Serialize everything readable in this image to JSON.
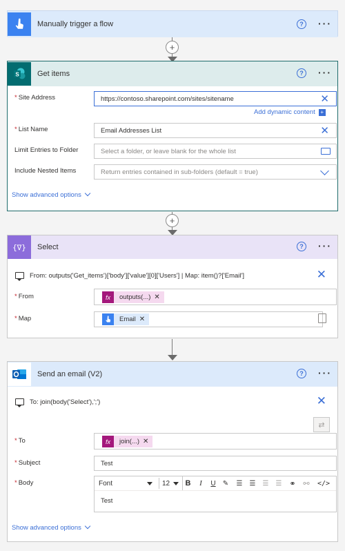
{
  "trigger": {
    "title": "Manually trigger a flow",
    "help": "?",
    "more": "···"
  },
  "get_items": {
    "title": "Get items",
    "help": "?",
    "more": "···",
    "site_address": {
      "label": "Site Address",
      "required": "*",
      "value": "https://contoso.sharepoint.com/sites/sitename"
    },
    "add_dynamic": "Add dynamic content",
    "list_name": {
      "label": "List Name",
      "required": "*",
      "value": "Email Addresses List"
    },
    "limit_folder": {
      "label": "Limit Entries to Folder",
      "placeholder": "Select a folder, or leave blank for the whole list"
    },
    "nested": {
      "label": "Include Nested Items",
      "placeholder": "Return entries contained in sub-folders (default = true)"
    },
    "advanced": "Show advanced options"
  },
  "select": {
    "title": "Select",
    "help": "?",
    "more": "···",
    "comment": "From: outputs('Get_items')['body']['value'][0]['Users'] | Map: item()?['Email']",
    "from": {
      "label": "From",
      "required": "*",
      "token": "outputs(...)",
      "token_icon": "fx"
    },
    "map": {
      "label": "Map",
      "required": "*",
      "token": "Email"
    }
  },
  "email": {
    "title": "Send an email (V2)",
    "help": "?",
    "more": "···",
    "comment": "To: join(body('Select'),';')",
    "to": {
      "label": "To",
      "required": "*",
      "token": "join(...)",
      "token_icon": "fx"
    },
    "subject": {
      "label": "Subject",
      "required": "*",
      "value": "Test"
    },
    "body": {
      "label": "Body",
      "required": "*",
      "font": "Font",
      "size": "12",
      "text": "Test"
    },
    "toolbar": {
      "bold": "B",
      "italic": "I",
      "underline": "U"
    },
    "advanced": "Show advanced options"
  },
  "colors": {
    "trigger_header": "#dceafb",
    "sharepoint_header": "#ddecec",
    "select_header": "#e9e3f7",
    "email_header": "#dceafb",
    "accent": "#3b6fd6",
    "fx_token": "#f5d9ef"
  }
}
